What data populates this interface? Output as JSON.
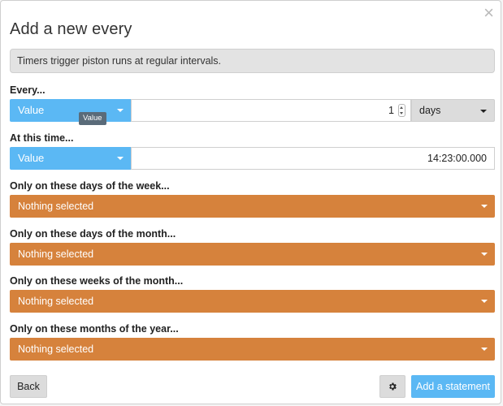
{
  "dialog": {
    "title": "Add a new every",
    "close_glyph": "×",
    "info_text": "Timers trigger piston runs at regular intervals."
  },
  "every": {
    "label": "Every...",
    "type_select": "Value",
    "tooltip": "Value",
    "amount": "1",
    "unit_select": "days"
  },
  "at_time": {
    "label": "At this time...",
    "type_select": "Value",
    "time_value": "14:23:00.000"
  },
  "filters": [
    {
      "label": "Only on these days of the week...",
      "value": "Nothing selected"
    },
    {
      "label": "Only on these days of the month...",
      "value": "Nothing selected"
    },
    {
      "label": "Only on these weeks of the month...",
      "value": "Nothing selected"
    },
    {
      "label": "Only on these months of the year...",
      "value": "Nothing selected"
    }
  ],
  "footer": {
    "back_label": "Back",
    "settings_icon": "gear-icon",
    "add_label": "Add a statement"
  },
  "colors": {
    "accent_blue": "#5bb8f4",
    "filter_orange": "#d6823c",
    "neutral_gray": "#dcdcdc"
  }
}
